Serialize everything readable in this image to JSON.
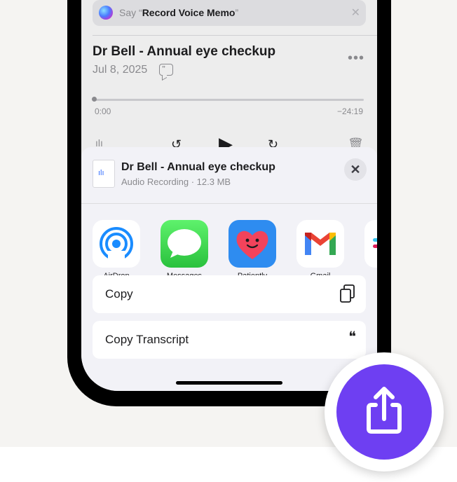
{
  "siri_banner": {
    "prefix": "Say “",
    "phrase": "Record Voice Memo",
    "suffix": "”",
    "close_glyph": "✕"
  },
  "recording": {
    "title": "Dr Bell - Annual eye checkup",
    "date": "Jul 8, 2025",
    "more_glyph": "•••",
    "time_start": "0:00",
    "time_remaining": "−24:19",
    "progress": 0.0
  },
  "share_sheet": {
    "file_title": "Dr Bell - Annual eye checkup",
    "file_subtitle": "Audio Recording · 12.3 MB",
    "close_glyph": "✕",
    "apps": [
      {
        "label": "AirDrop",
        "icon": "airdrop-icon"
      },
      {
        "label": "Messages",
        "icon": "messages-icon"
      },
      {
        "label": "Patiently",
        "icon": "patiently-heart-icon"
      },
      {
        "label": "Gmail",
        "icon": "gmail-icon"
      }
    ],
    "actions": [
      {
        "label": "Copy",
        "icon": "copy-icon"
      },
      {
        "label": "Copy Transcript",
        "icon": "quote-icon"
      }
    ]
  },
  "colors": {
    "accent": "#6e3ff2",
    "airdrop_blue": "#1a8cff",
    "patiently_blue": "#2e8cf0"
  }
}
